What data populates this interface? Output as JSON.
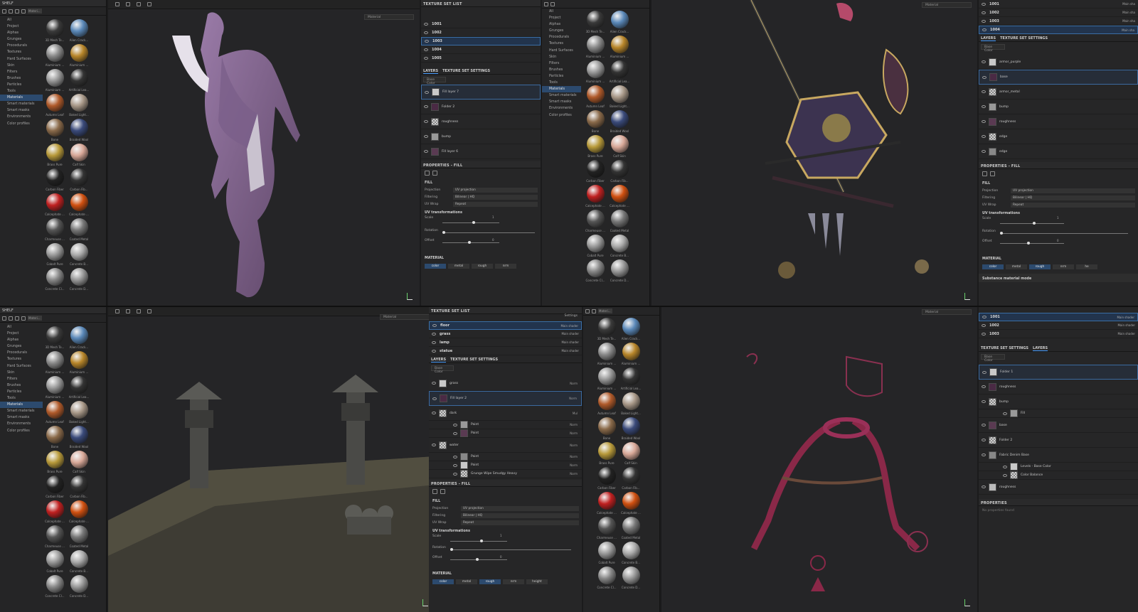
{
  "shelf": {
    "title": "SHELF",
    "search": "Materi...",
    "categories": [
      "All",
      "Project",
      "Alphas",
      "Grunges",
      "Procedurals",
      "Textures",
      "Hard Surfaces",
      "Skin",
      "Filters",
      "Brushes",
      "Particles",
      "Tools",
      "Materials",
      "Smart materials",
      "Smart masks",
      "Environments",
      "Color profiles"
    ],
    "selected_category": "Materials",
    "materials": [
      "3D Mesh Te...",
      "Alien Crack...",
      "Aluminium ...",
      "Aluminium ...",
      "Aluminium ...",
      "Artificial Lea...",
      "Autumn Leaf",
      "Baked Light...",
      "Bone",
      "Braided Wool",
      "Brass Pure",
      "Calf Skin",
      "Carbon Fiber",
      "Carbon Fib...",
      "Calcephate ...",
      "Calcephate ...",
      "Charmeuse ...",
      "Coated Metal",
      "Cobalt Pure",
      "Concrete B...",
      "Concrete Cl...",
      "Concrete D..."
    ]
  },
  "viewport_mode": "Material",
  "top_panel": {
    "texture_set_title": "TEXTURE SET LIST",
    "texture_sets": [
      "1001",
      "1002",
      "1003",
      "1004",
      "1005"
    ],
    "selected_set": "1003",
    "layers_tab": "LAYERS",
    "tss_tab": "TEXTURE SET SETTINGS",
    "channel": "Base Color",
    "layers": [
      "Fill layer 7",
      "Folder 2",
      "roughness",
      "bump",
      "Fill layer 6"
    ],
    "properties_title": "PROPERTIES - FILL",
    "fill_label": "FILL",
    "projection_label": "Projection",
    "projection": "UV projection",
    "filtering_label": "Filtering",
    "filtering": "Bilinear | HQ",
    "uvwrap_label": "UV Wrap",
    "uvwrap": "Repeat",
    "uvt": "UV transformations",
    "scale_label": "Scale",
    "scale_val": "1",
    "rotation_label": "Rotation",
    "offset_label": "Offset",
    "offset_val": "0",
    "material_label": "MATERIAL",
    "channels": [
      "color",
      "metal",
      "rough",
      "nrm"
    ]
  },
  "bottom_panel": {
    "texture_set_title": "TEXTURE SET LIST",
    "settings": "Settings",
    "texture_sets": [
      {
        "name": "floor",
        "shader": "Main shader"
      },
      {
        "name": "grass",
        "shader": "Main shader"
      },
      {
        "name": "lamp",
        "shader": "Main shader"
      },
      {
        "name": "statue",
        "shader": "Main shader"
      }
    ],
    "layers_tab": "LAYERS",
    "tss_tab": "TEXTURE SET SETTINGS",
    "channel": "Base Color",
    "layers": [
      {
        "name": "grass",
        "blend": "Norm",
        "op": "100"
      },
      {
        "name": "Fill layer 2",
        "blend": "Norm",
        "op": "100"
      },
      {
        "name": "dark",
        "blend": "Mul",
        "op": "100"
      },
      {
        "name": "Paint",
        "blend": "Norm",
        "op": "100"
      },
      {
        "name": "Paint",
        "blend": "Norm",
        "op": "100"
      },
      {
        "name": "water",
        "blend": "Norm",
        "op": "100"
      },
      {
        "name": "Paint",
        "blend": "Norm",
        "op": "100"
      },
      {
        "name": "Paint",
        "blend": "Norm",
        "op": "100"
      },
      {
        "name": "Grunge Wipe Smudgy Heavy",
        "blend": "Norm",
        "op": "100"
      }
    ],
    "properties_title": "PROPERTIES - FILL",
    "fill_label": "FILL",
    "projection": "UV projection",
    "filtering": "Bilinear | HQ",
    "uvwrap": "Repeat",
    "uvt": "UV transformations",
    "scale_val": "1",
    "offset_val": "0",
    "material_label": "MATERIAL",
    "channels": [
      "color",
      "metal",
      "rough",
      "nrm",
      "height"
    ]
  },
  "right_top": {
    "texture_sets": [
      "1001",
      "1002",
      "1003",
      "1004"
    ],
    "shader": "Main sha",
    "layers_tab": "LAYERS",
    "tss_tab": "TEXTURE SET SETTINGS",
    "channel": "Base Color",
    "layers": [
      "armor_purple",
      "base",
      "armor_metal",
      "bump",
      "roughness",
      "edge",
      "edge"
    ],
    "properties_title": "PROPERTIES - FILL",
    "fill_label": "FILL",
    "projection": "UV projection",
    "filtering": "Bilinear | HQ",
    "uvwrap": "Repeat",
    "uvt": "UV transformations",
    "scale_val": "1",
    "offset_val": "0",
    "material_label": "MATERIAL",
    "channels": [
      "color",
      "metal",
      "rough",
      "nrm",
      "he"
    ],
    "material_mode": "Substance material mode"
  },
  "right_bottom": {
    "texture_sets": [
      "1001",
      "1002",
      "1003"
    ],
    "shader": "Main shader",
    "tss_tab": "TEXTURE SET SETTINGS",
    "layers_tab": "LAYERS",
    "channel": "Base Color",
    "layers": [
      "Folder 1",
      "roughness",
      "bump",
      "Fill",
      "base",
      "Folder 2",
      "Fabric Denim Base",
      "Levels - Base Color",
      "Color Balance",
      "roughness"
    ],
    "properties_title": "PROPERTIES",
    "no_props": "No properties found"
  },
  "colors": {
    "accent": "#4a9eff",
    "selection": "#2c4a6e",
    "background": "#252527"
  }
}
